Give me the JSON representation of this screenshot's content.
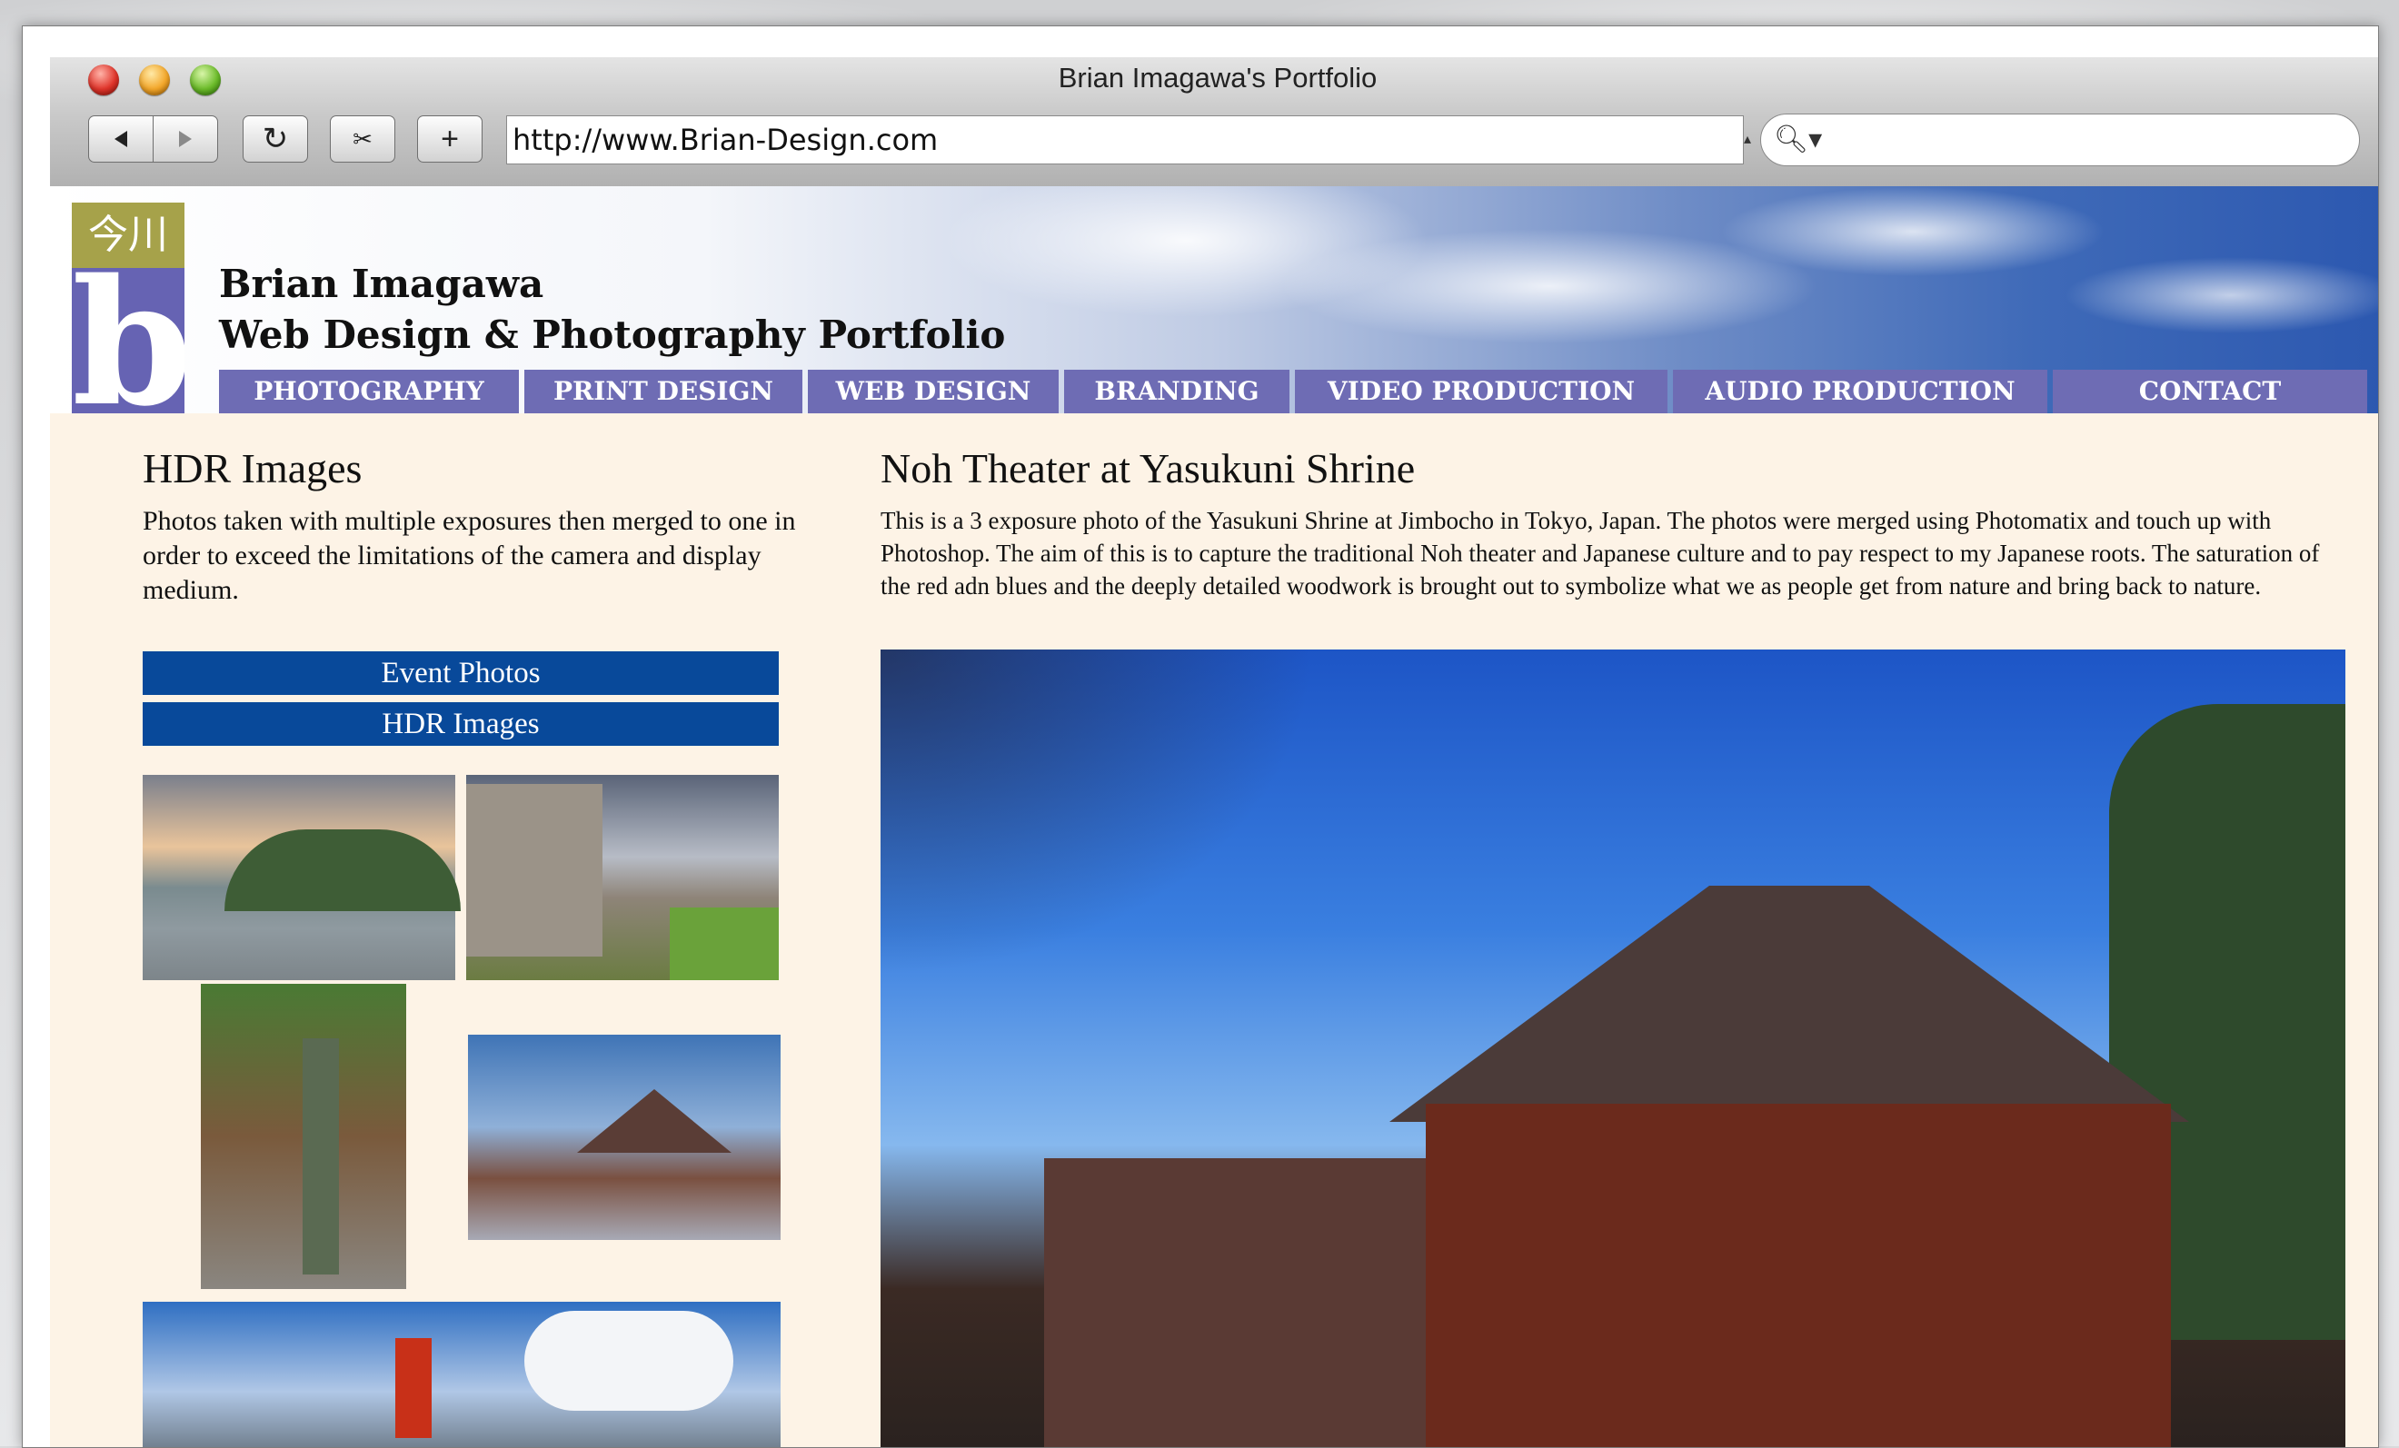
{
  "window": {
    "title": "Brian Imagawa's Portfolio"
  },
  "toolbar": {
    "back_icon": "back-arrow-icon",
    "forward_icon": "forward-arrow-icon",
    "reload_icon": "reload-icon",
    "snippet_icon": "snippet-icon",
    "add_icon": "add-bookmark-icon",
    "url": "http://www.Brian-Design.com",
    "search_value": ""
  },
  "site": {
    "logo_kanji": "今川",
    "logo_letter": "b",
    "name_line1": "Brian Imagawa",
    "name_line2": "Web Design & Photography Portfolio"
  },
  "nav": [
    "PHOTOGRAPHY",
    "PRINT DESIGN",
    "WEB DESIGN",
    "BRANDING",
    "VIDEO PRODUCTION",
    "AUDIO PRODUCTION",
    "CONTACT"
  ],
  "sidebar": {
    "heading": "HDR Images",
    "description": "Photos taken with multiple exposures then merged to one in order to exceed the limitations of the camera and display medium.",
    "buttons": [
      "Event Photos",
      "HDR Images"
    ]
  },
  "main": {
    "heading": "Noh Theater at Yasukuni Shrine",
    "description": "This is a 3 exposure photo of the Yasukuni Shrine at Jimbocho in Tokyo, Japan. The photos were merged using Photomatix and touch up with Photoshop. The aim of this is to capture the traditional Noh theater and Japanese culture and to pay respect to my Japanese roots. The saturation of the red adn blues and the deeply detailed woodwork is brought out to symbolize what we as people get from nature and bring back to nature."
  },
  "colors": {
    "nav_bg": "#6e6cb4",
    "button_bg": "#08499a",
    "page_bg": "#fdf3e6",
    "logo_olive": "#a6a24a",
    "logo_purple": "#6663b3"
  }
}
